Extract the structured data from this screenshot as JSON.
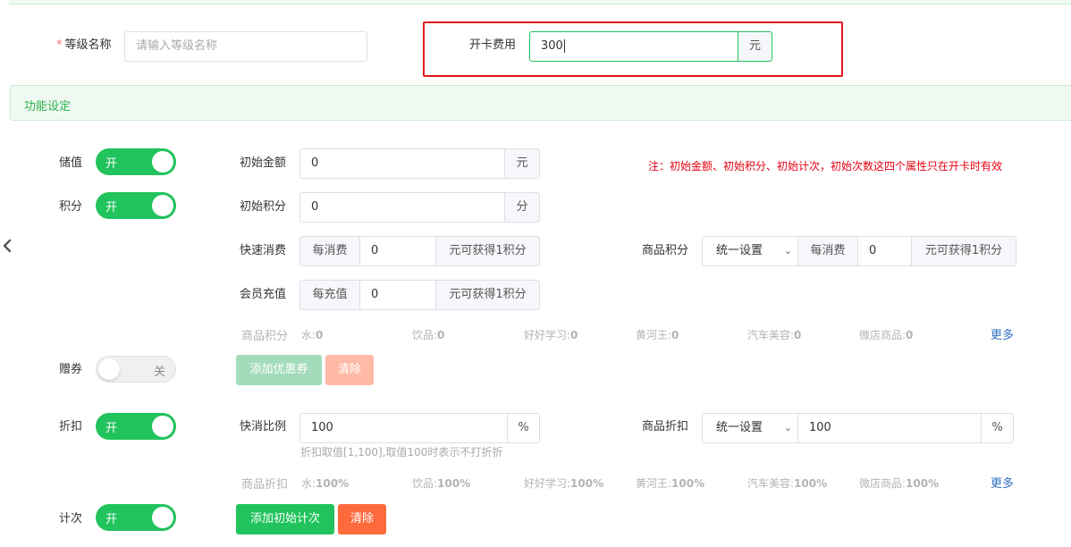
{
  "basic": {
    "level_name_label": "等级名称",
    "level_name_required": "*",
    "level_name_placeholder": "请输入等级名称",
    "card_fee_label": "开卡费用",
    "card_fee_value": "300",
    "card_fee_unit": "元"
  },
  "section_title": "功能设定",
  "stored_value": {
    "label": "储值",
    "switch_text": "开",
    "initial_amount_label": "初始金额",
    "initial_amount_value": "0",
    "initial_amount_unit": "元",
    "note": "注：初始金额、初始积分、初始计次，初始次数这四个属性只在开卡时有效"
  },
  "points": {
    "label": "积分",
    "switch_text": "开",
    "initial_points_label": "初始积分",
    "initial_points_value": "0",
    "initial_points_unit": "分",
    "quick_label": "快速消费",
    "quick_prefix": "每消费",
    "quick_value": "0",
    "quick_suffix": "元可获得1积分",
    "goods_label": "商品积分",
    "goods_select": "统一设置",
    "goods_prefix": "每消费",
    "goods_value": "0",
    "goods_suffix": "元可获得1积分",
    "recharge_label": "会员充值",
    "recharge_prefix": "每充值",
    "recharge_value": "0",
    "recharge_suffix": "元可获得1积分",
    "summary_label": "商品积分",
    "summary": [
      {
        "name": "水:",
        "value": "0"
      },
      {
        "name": "饮品:",
        "value": "0"
      },
      {
        "name": "好好学习:",
        "value": "0"
      },
      {
        "name": "黄河王:",
        "value": "0"
      },
      {
        "name": "汽车美容:",
        "value": "0"
      },
      {
        "name": "微店商品:",
        "value": "0"
      }
    ],
    "more": "更多"
  },
  "coupon": {
    "label": "赠券",
    "switch_text": "关",
    "add_button": "添加优惠券",
    "clear_button": "清除"
  },
  "discount": {
    "label": "折扣",
    "switch_text": "开",
    "quick_label": "快消比例",
    "quick_value": "100",
    "quick_unit": "%",
    "hint": "折扣取值[1,100],取值100时表示不打折折",
    "goods_label": "商品折扣",
    "goods_select": "统一设置",
    "goods_value": "100",
    "goods_unit": "%",
    "summary_label": "商品折扣",
    "summary": [
      {
        "name": "水:",
        "value": "100%"
      },
      {
        "name": "饮品:",
        "value": "100%"
      },
      {
        "name": "好好学习:",
        "value": "100%"
      },
      {
        "name": "黄河王:",
        "value": "100%"
      },
      {
        "name": "汽车美容:",
        "value": "100%"
      },
      {
        "name": "微店商品:",
        "value": "100%"
      }
    ],
    "more": "更多"
  },
  "count": {
    "label": "计次",
    "switch_text": "开",
    "add_button": "添加初始计次",
    "clear_button": "清除"
  },
  "colors": {
    "accent_green": "#21c35c",
    "highlight_red": "#e8171d",
    "note_red": "#e60012",
    "clear_orange": "#ff6a3d",
    "link_blue": "#2f6fbf"
  },
  "icons": {
    "back": "chevron-left-icon",
    "select": "chevron-down-icon"
  }
}
